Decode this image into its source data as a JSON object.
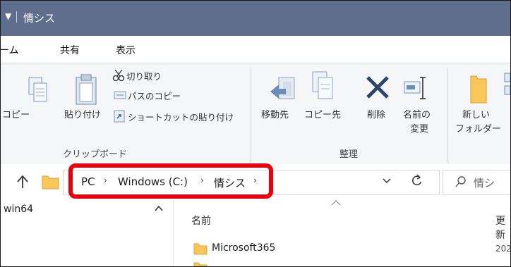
{
  "titlebar": {
    "quick_access_glyph": "▼",
    "title": "情シス"
  },
  "tabs": [
    {
      "label": "ーム"
    },
    {
      "label": "共有"
    },
    {
      "label": "表示"
    }
  ],
  "ribbon": {
    "clipboard": {
      "copy_partial": "コピー",
      "paste": "貼り付け",
      "cut": "切り取り",
      "copy_path": "パスのコピー",
      "paste_shortcut": "ショートカットの貼り付け",
      "group_label": "クリップボード"
    },
    "organize": {
      "move_to": "移動先",
      "copy_to": "コピー先",
      "delete": "削除",
      "rename_line1": "名前の",
      "rename_line2": "変更",
      "group_label": "整理"
    },
    "new": {
      "new_folder_line1": "新しい",
      "new_folder_line2": "フォルダー"
    }
  },
  "address": {
    "crumbs": [
      "PC",
      "Windows (C:)",
      "情シス"
    ],
    "separator": "›",
    "search_placeholder": "情シ"
  },
  "nav_pane": {
    "items": [
      "win64"
    ]
  },
  "file_list": {
    "columns": {
      "name": "名前",
      "date_partial": "更新"
    },
    "rows": [
      {
        "name": "Microsoft365",
        "date_partial": "202"
      }
    ]
  },
  "colors": {
    "titlebar": "#5f6e8c",
    "highlight": "#e8000c",
    "folder": "#f8c75a"
  }
}
